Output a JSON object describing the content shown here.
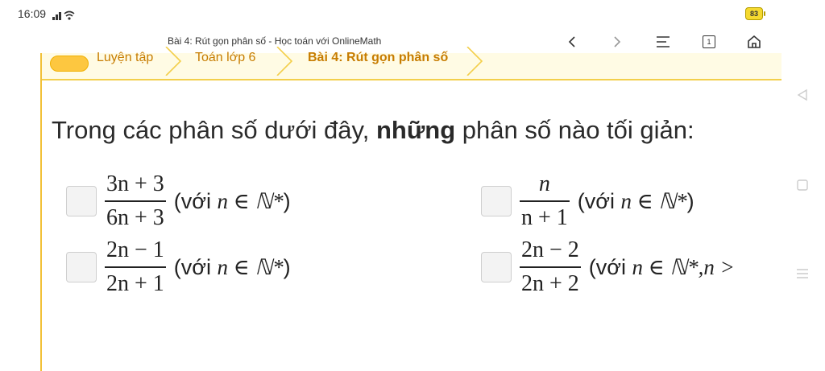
{
  "status": {
    "time": "16:09",
    "battery": "83"
  },
  "browser": {
    "title": "Bài 4: Rút gọn phân số - Học toán với OnlineMath",
    "tabs_count": "1"
  },
  "breadcrumb": {
    "items": [
      "Luyện tập",
      "Toán lớp 6",
      "Bài 4: Rút gọn phân số"
    ]
  },
  "question": {
    "pre": "Trong các phân số dưới đây, ",
    "bold": "những",
    "post": " phân số nào tối giản:"
  },
  "options": [
    {
      "num": "3n + 3",
      "den": "6n + 3",
      "cond_prefix": "(với ",
      "cond_math": "n ∈ ℕ*",
      "cond_suffix": ")"
    },
    {
      "num": "n",
      "den": "n + 1",
      "cond_prefix": "(với ",
      "cond_math": "n ∈ ℕ*",
      "cond_suffix": ")"
    },
    {
      "num": "2n − 1",
      "den": "2n + 1",
      "cond_prefix": "(với ",
      "cond_math": "n ∈ ℕ*",
      "cond_suffix": ")"
    },
    {
      "num": "2n − 2",
      "den": "2n + 2",
      "cond_prefix": "(với ",
      "cond_math": "n ∈ ℕ*,n >",
      "cond_suffix": ""
    }
  ],
  "colors": {
    "accent": "#f2c037",
    "crumb_text": "#c77c00"
  }
}
